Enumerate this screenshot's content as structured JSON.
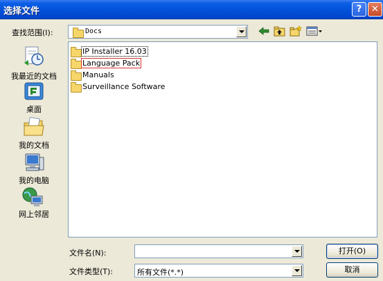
{
  "window": {
    "title": "选择文件",
    "help_glyph": "?",
    "close_glyph": "✕"
  },
  "lookin": {
    "label": "查找范围(I):",
    "value": "Docs"
  },
  "places": [
    {
      "label": "我最近的文档",
      "icon": "recent-documents-icon"
    },
    {
      "label": "桌面",
      "icon": "desktop-icon"
    },
    {
      "label": "我的文档",
      "icon": "my-documents-icon"
    },
    {
      "label": "我的电脑",
      "icon": "my-computer-icon"
    },
    {
      "label": "网上邻居",
      "icon": "network-places-icon"
    }
  ],
  "files": [
    {
      "name": "IP Installer 16.03"
    },
    {
      "name": "Language Pack"
    },
    {
      "name": "Manuals"
    },
    {
      "name": "Surveillance Software"
    }
  ],
  "filename": {
    "label": "文件名(N):",
    "value": ""
  },
  "filetype": {
    "label": "文件类型(T):",
    "value": "所有文件(*.*)"
  },
  "buttons": {
    "open": "打开(O)",
    "cancel": "取消"
  },
  "colors": {
    "titlebar": "#0250d8",
    "dialog_bg": "#ece9d8",
    "selection_outline": "#dd3333"
  }
}
